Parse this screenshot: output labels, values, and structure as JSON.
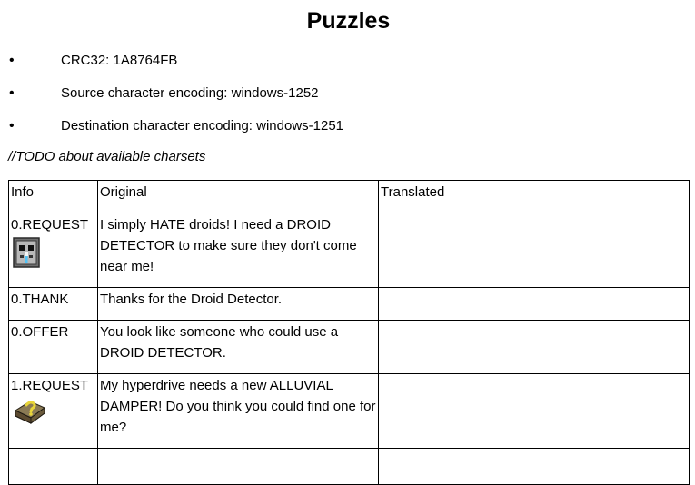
{
  "document": {
    "title": "Puzzles",
    "bullets": [
      {
        "text": "CRC32: 1A8764FB"
      },
      {
        "text": "Source character encoding: windows-1252"
      },
      {
        "text": "Destination character encoding: windows-1251"
      }
    ],
    "bullet_symbol": "•",
    "note": "//TODO about available charsets"
  },
  "table": {
    "headers": {
      "info": "Info",
      "original": "Original",
      "translated": "Translated"
    },
    "rows": [
      {
        "info": "0.REQUEST",
        "icon": "droid-detector-icon",
        "original": "I simply HATE droids! I need a DROID DETECTOR to make sure they don't come near me!",
        "translated": ""
      },
      {
        "info": "0.THANK",
        "icon": "",
        "original": "Thanks for the Droid Detector.",
        "translated": ""
      },
      {
        "info": "0.OFFER",
        "icon": "",
        "original": "You look like someone who could use a DROID DETECTOR.",
        "translated": ""
      },
      {
        "info": "1.REQUEST",
        "icon": "alluvial-damper-icon",
        "original": "My hyperdrive needs a new ALLUVIAL DAMPER! Do you think you could find one for me?",
        "translated": ""
      }
    ]
  }
}
